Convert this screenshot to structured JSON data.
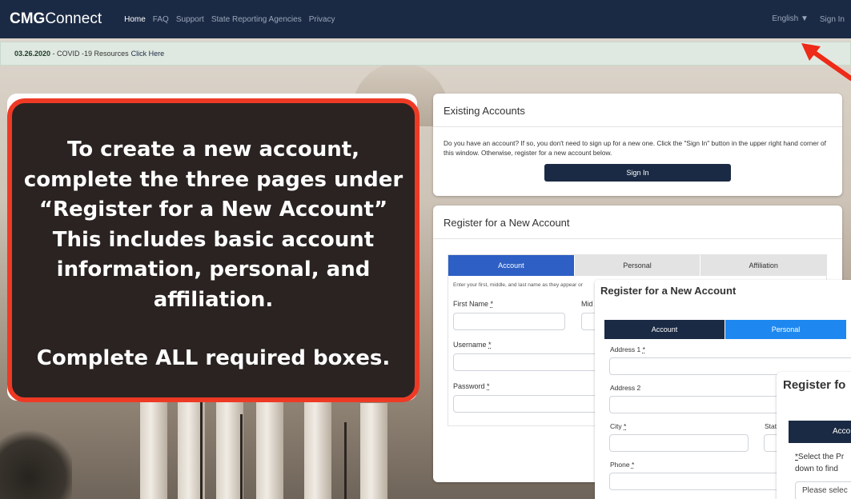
{
  "navbar": {
    "brand_bold": "CMG",
    "brand_rest": "Connect",
    "links": [
      "Home",
      "FAQ",
      "Support",
      "State Reporting Agencies",
      "Privacy"
    ],
    "language": "English",
    "sign_in": "Sign In"
  },
  "banner": {
    "date": "03.26.2020",
    "text": " - COVID -19 Resources",
    "link": "Click Here"
  },
  "existing": {
    "title": "Existing Accounts",
    "body": "Do you have an account? If so, you don't need to sign up for a new one. Click the \"Sign In\" button in the upper right hand corner of this window. Otherwise, register for a new account below.",
    "button": "Sign In"
  },
  "register1": {
    "title": "Register for a New Account",
    "tabs": [
      "Account",
      "Personal",
      "Affiliation"
    ],
    "instruction": "Enter your first, middle, and last name as they appear or",
    "first_name": "First Name",
    "middle": "Mid",
    "username": "Username",
    "password": "Password",
    "req": "*"
  },
  "register2": {
    "title": "Register for a New Account",
    "tabs": [
      "Account",
      "Personal"
    ],
    "address1": "Address 1",
    "address2": "Address 2",
    "city": "City",
    "state": "Stat",
    "phone": "Phone",
    "req": "*"
  },
  "register3": {
    "title": "Register fo",
    "tab": "Acco",
    "select_line1": "Select the Pr",
    "select_line2": "down to find",
    "placeholder": "Please selec",
    "req": "*"
  },
  "callout": {
    "lines": [
      "To create a new account,",
      "complete the three pages under",
      "“Register for a New Account”",
      "This includes basic account",
      "information, personal, and",
      "affiliation."
    ],
    "sub": "Complete ALL required boxes."
  },
  "colors": {
    "navbar": "#1b2a44",
    "tab_active": "#2d5fc4",
    "tab_personal": "#1e88f0",
    "callout_border": "#ee3a25",
    "callout_bg": "#2a2322"
  }
}
